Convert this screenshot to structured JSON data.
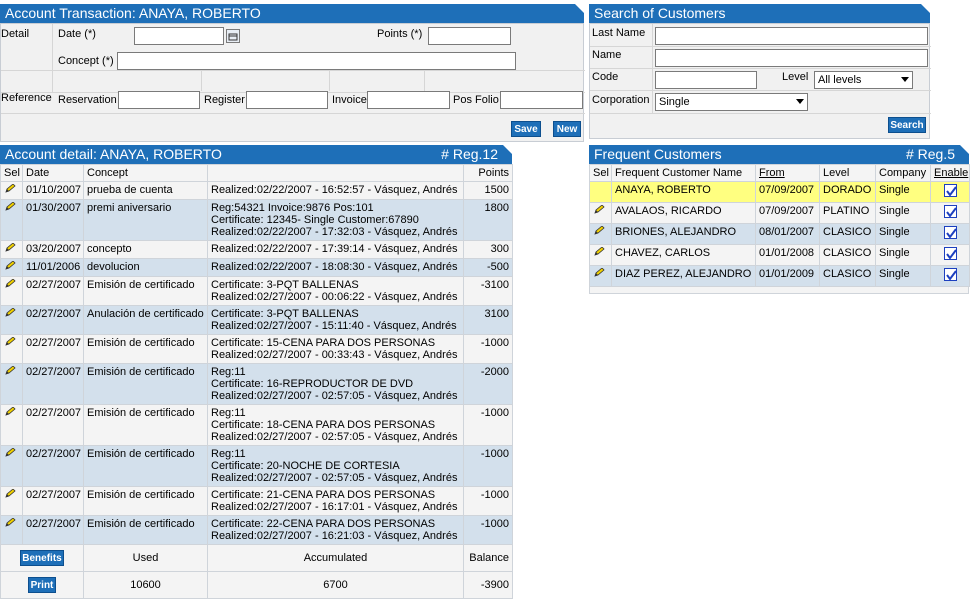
{
  "account_transaction": {
    "title": "Account Transaction: ANAYA, ROBERTO",
    "detail_label": "Detail",
    "date_label": "Date (*)",
    "date_value": "",
    "points_label": "Points (*)",
    "points_value": "",
    "concept_label": "Concept (*)",
    "concept_value": "",
    "reference_label": "Reference",
    "reservation_label": "Reservation",
    "register_label": "Register",
    "invoice_label": "Invoice",
    "pos_folio_label": "Pos Folio",
    "save_label": "Save",
    "new_label": "New"
  },
  "search_customers": {
    "title": "Search of Customers",
    "last_name_label": "Last Name",
    "name_label": "Name",
    "code_label": "Code",
    "level_label": "Level",
    "level_value": "All levels",
    "corporation_label": "Corporation",
    "corporation_value": "Single",
    "search_label": "Search"
  },
  "account_detail": {
    "title": "Account detail: ANAYA, ROBERTO",
    "reg_count": "# Reg.12",
    "columns": [
      "Sel",
      "Date",
      "Concept",
      "",
      "Points"
    ],
    "rows": [
      {
        "date": "01/10/2007",
        "concept": "prueba de cuenta",
        "detail": [
          "Realized:02/22/2007 - 16:52:57 - Vásquez, Andrés"
        ],
        "points": "1500"
      },
      {
        "date": "01/30/2007",
        "concept": "premi aniversario",
        "detail": [
          "Reg:54321 Invoice:9876 Pos:101",
          "Certificate: 12345- Single Customer:67890",
          "Realized:02/22/2007 - 17:32:03 - Vásquez, Andrés"
        ],
        "points": "1800"
      },
      {
        "date": "03/20/2007",
        "concept": "concepto",
        "detail": [
          "Realized:02/22/2007 - 17:39:14 - Vásquez, Andrés"
        ],
        "points": "300"
      },
      {
        "date": "11/01/2006",
        "concept": "devolucion",
        "detail": [
          "Realized:02/22/2007 - 18:08:30 - Vásquez, Andrés"
        ],
        "points": "-500"
      },
      {
        "date": "02/27/2007",
        "concept": "Emisión de certificado",
        "detail": [
          "Certificate: 3-PQT BALLENAS",
          "Realized:02/27/2007 - 00:06:22 - Vásquez, Andrés"
        ],
        "points": "-3100"
      },
      {
        "date": "02/27/2007",
        "concept": "Anulación de certificado",
        "detail": [
          "Certificate: 3-PQT BALLENAS",
          "Realized:02/27/2007 - 15:11:40 - Vásquez, Andrés"
        ],
        "points": "3100"
      },
      {
        "date": "02/27/2007",
        "concept": "Emisión de certificado",
        "detail": [
          "Certificate: 15-CENA PARA DOS PERSONAS",
          "Realized:02/27/2007 - 00:33:43 - Vásquez, Andrés"
        ],
        "points": "-1000"
      },
      {
        "date": "02/27/2007",
        "concept": "Emisión de certificado",
        "detail": [
          "Reg:11",
          "Certificate: 16-REPRODUCTOR DE DVD",
          "Realized:02/27/2007 - 02:57:05 - Vásquez, Andrés"
        ],
        "points": "-2000"
      },
      {
        "date": "02/27/2007",
        "concept": "Emisión de certificado",
        "detail": [
          "Reg:11",
          "Certificate: 18-CENA PARA DOS PERSONAS",
          "Realized:02/27/2007 - 02:57:05 - Vásquez, Andrés"
        ],
        "points": "-1000"
      },
      {
        "date": "02/27/2007",
        "concept": "Emisión de certificado",
        "detail": [
          "Reg:11",
          "Certificate: 20-NOCHE DE CORTESIA",
          "Realized:02/27/2007 - 02:57:05 - Vásquez, Andrés"
        ],
        "points": "-1000"
      },
      {
        "date": "02/27/2007",
        "concept": "Emisión de certificado",
        "detail": [
          "Certificate: 21-CENA PARA DOS PERSONAS",
          "Realized:02/27/2007 - 16:17:01 - Vásquez, Andrés"
        ],
        "points": "-1000"
      },
      {
        "date": "02/27/2007",
        "concept": "Emisión de certificado",
        "detail": [
          "Certificate: 22-CENA PARA DOS PERSONAS",
          "Realized:02/27/2007 - 16:21:03 - Vásquez, Andrés"
        ],
        "points": "-1000"
      }
    ],
    "benefits_label": "Benefits",
    "print_label": "Print",
    "used_label": "Used",
    "accumulated_label": "Accumulated",
    "balance_label": "Balance",
    "used_value": "10600",
    "accumulated_value": "6700",
    "balance_value": "-3900"
  },
  "frequent_customers": {
    "title": "Frequent Customers",
    "reg_count": "# Reg.5",
    "columns": [
      "Sel",
      "Frequent Customer Name",
      "From",
      "Level",
      "Company",
      "Enable"
    ],
    "rows": [
      {
        "name": "ANAYA, ROBERTO",
        "from": "07/09/2007",
        "level": "DORADO",
        "company": "Single",
        "enabled": true,
        "selected": true
      },
      {
        "name": "AVALAOS, RICARDO",
        "from": "07/09/2007",
        "level": "PLATINO",
        "company": "Single",
        "enabled": true,
        "selected": false
      },
      {
        "name": "BRIONES, ALEJANDRO",
        "from": "08/01/2007",
        "level": "CLASICO",
        "company": "Single",
        "enabled": true,
        "selected": false
      },
      {
        "name": "CHAVEZ, CARLOS",
        "from": "01/01/2008",
        "level": "CLASICO",
        "company": "Single",
        "enabled": true,
        "selected": false
      },
      {
        "name": "DIAZ PEREZ, ALEJANDRO",
        "from": "01/01/2009",
        "level": "CLASICO",
        "company": "Single",
        "enabled": true,
        "selected": false
      }
    ]
  },
  "icons": {
    "edit": "pencil-icon",
    "calendar": "calendar-icon",
    "check": "checkbox-checked-icon"
  },
  "colors": {
    "header": "#1e6fb8",
    "row_alt": "#d3e0ec",
    "highlight": "#ffff80"
  }
}
